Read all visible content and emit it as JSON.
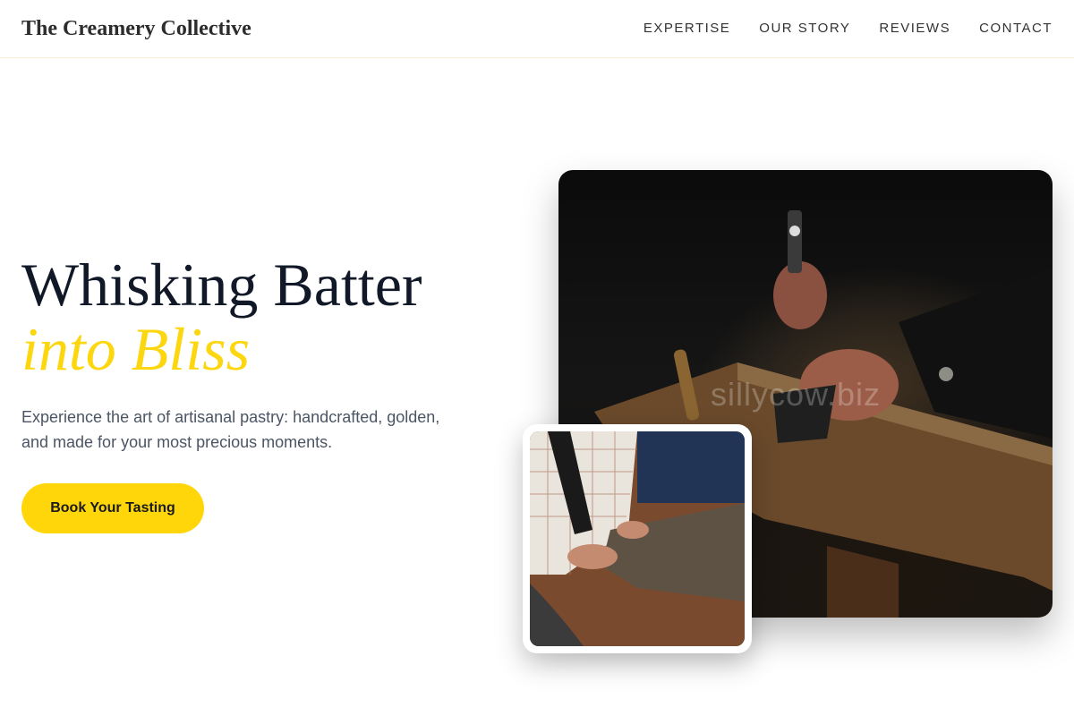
{
  "header": {
    "brand": "The Creamery Collective",
    "nav": [
      "EXPERTISE",
      "OUR STORY",
      "REVIEWS",
      "CONTACT"
    ]
  },
  "hero": {
    "title_line1": "Whisking Batter",
    "title_line2": "into Bliss",
    "subtitle": "Experience the art of artisanal pastry: handcrafted, golden, and made for your most precious moments.",
    "cta_label": "Book Your Tasting"
  },
  "images": {
    "main_alt": "Artisan hands working with tools on a rustic wooden bench",
    "inset_alt": "Tailor cutting fabric on a wooden table",
    "watermark": "sillycow.biz"
  },
  "colors": {
    "accent": "#fcd60f",
    "cta": "#ffd60a",
    "title": "#111827",
    "body_text": "#4b5563"
  }
}
